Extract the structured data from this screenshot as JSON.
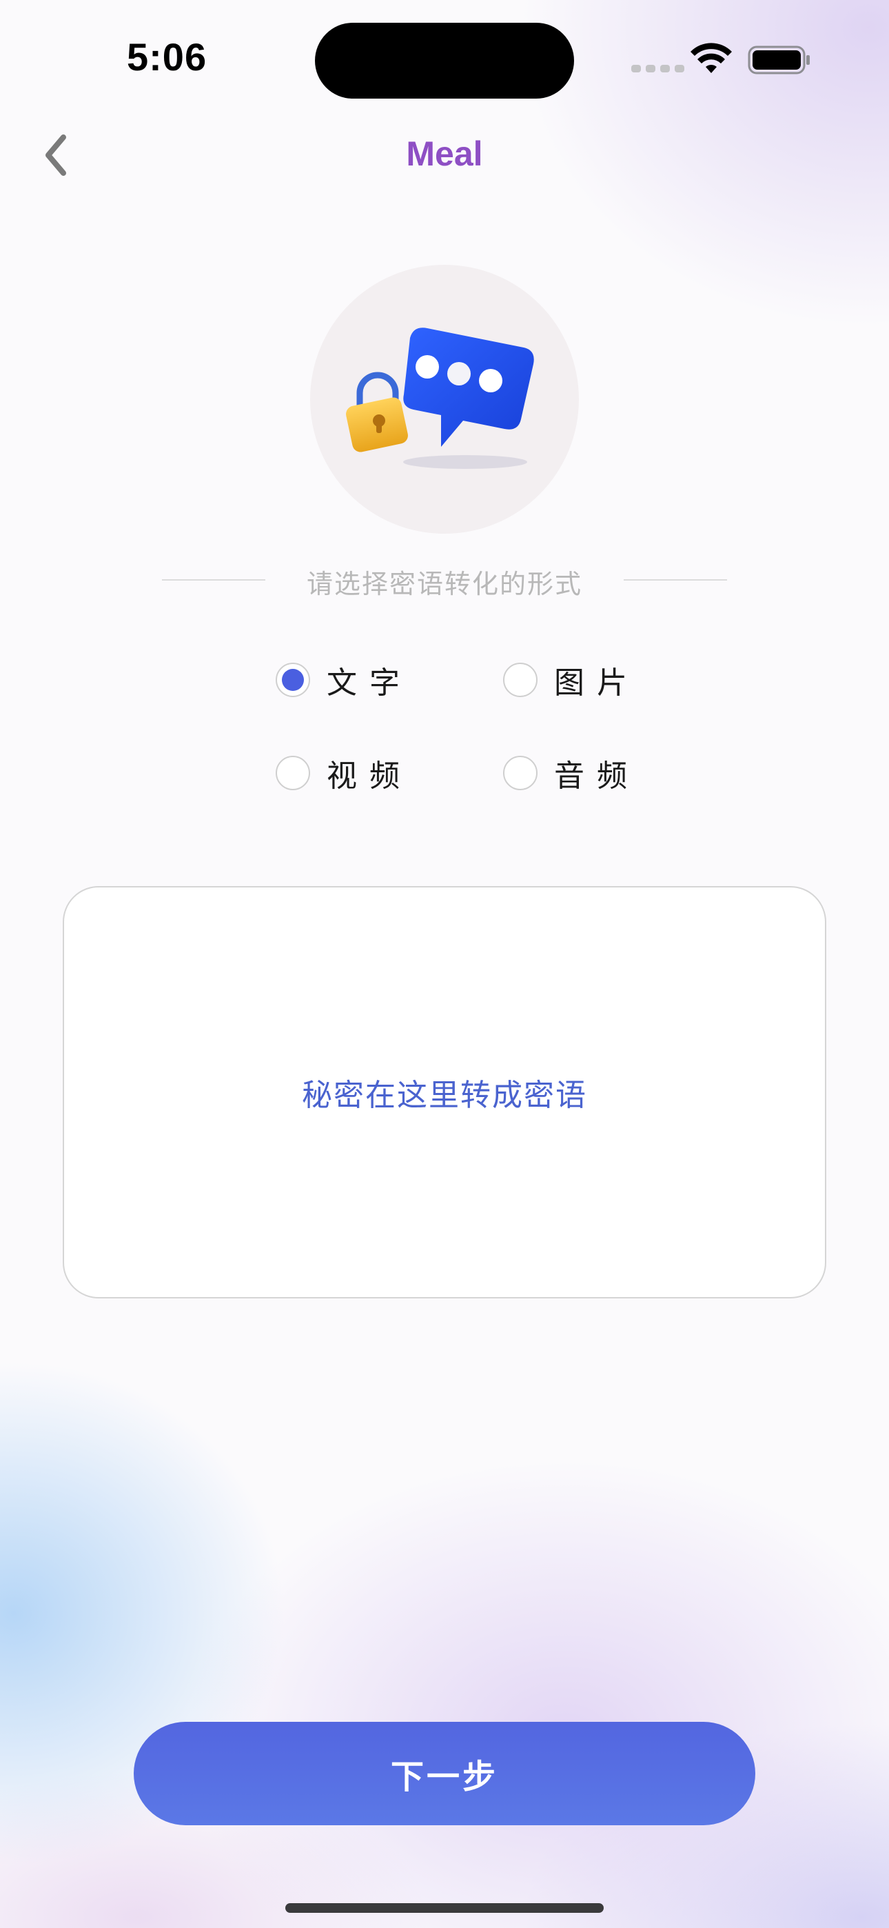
{
  "status_bar": {
    "time": "5:06"
  },
  "nav": {
    "title": "Meal",
    "back_icon": "chevron-left-icon"
  },
  "hero": {
    "icon": "locked-chat-bubble-icon"
  },
  "prompt": {
    "text": "请选择密语转化的形式"
  },
  "options": [
    {
      "label": "文字",
      "selected": true
    },
    {
      "label": "图片",
      "selected": false
    },
    {
      "label": "视频",
      "selected": false
    },
    {
      "label": "音频",
      "selected": false
    }
  ],
  "secret_box": {
    "placeholder": "秘密在这里转成密语"
  },
  "next_button": {
    "label": "下一步"
  },
  "colors": {
    "title": "#8e4fc4",
    "accent": "#4a5fe0",
    "placeholder": "#4a63cf",
    "button": "#5366e0"
  }
}
